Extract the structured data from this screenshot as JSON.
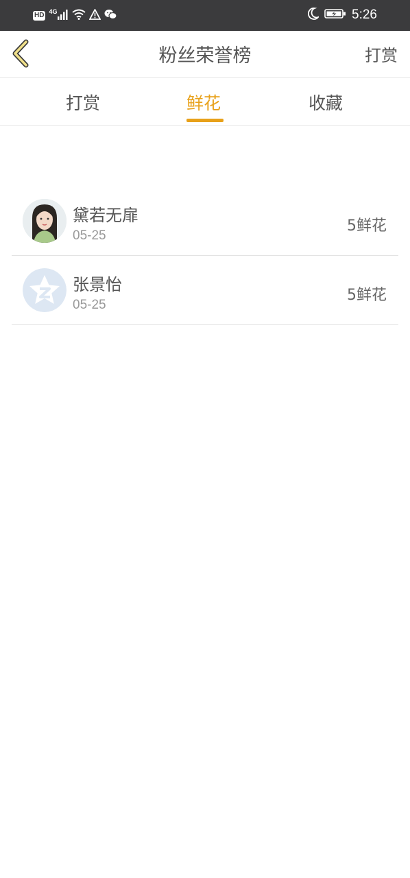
{
  "status_bar": {
    "hd": "HD",
    "network": "4G",
    "time": "5:26",
    "icons": [
      "signal-icon",
      "wifi-icon",
      "warning-icon",
      "wechat-icon",
      "moon-icon",
      "battery-icon"
    ]
  },
  "header": {
    "title": "粉丝荣誉榜",
    "action_label": "打赏",
    "back_icon": "chevron-left-icon"
  },
  "tabs": [
    {
      "label": "打赏",
      "active": false
    },
    {
      "label": "鲜花",
      "active": true
    },
    {
      "label": "收藏",
      "active": false
    }
  ],
  "list": [
    {
      "name": "黛若无扉",
      "date": "05-25",
      "value": "5鲜花",
      "avatar": "portrait"
    },
    {
      "name": "张景怡",
      "date": "05-25",
      "value": "5鲜花",
      "avatar": "default-star"
    }
  ],
  "colors": {
    "accent": "#e8a11a",
    "status_bar": "#3b3b3d",
    "text": "#555555",
    "muted": "#999999"
  }
}
